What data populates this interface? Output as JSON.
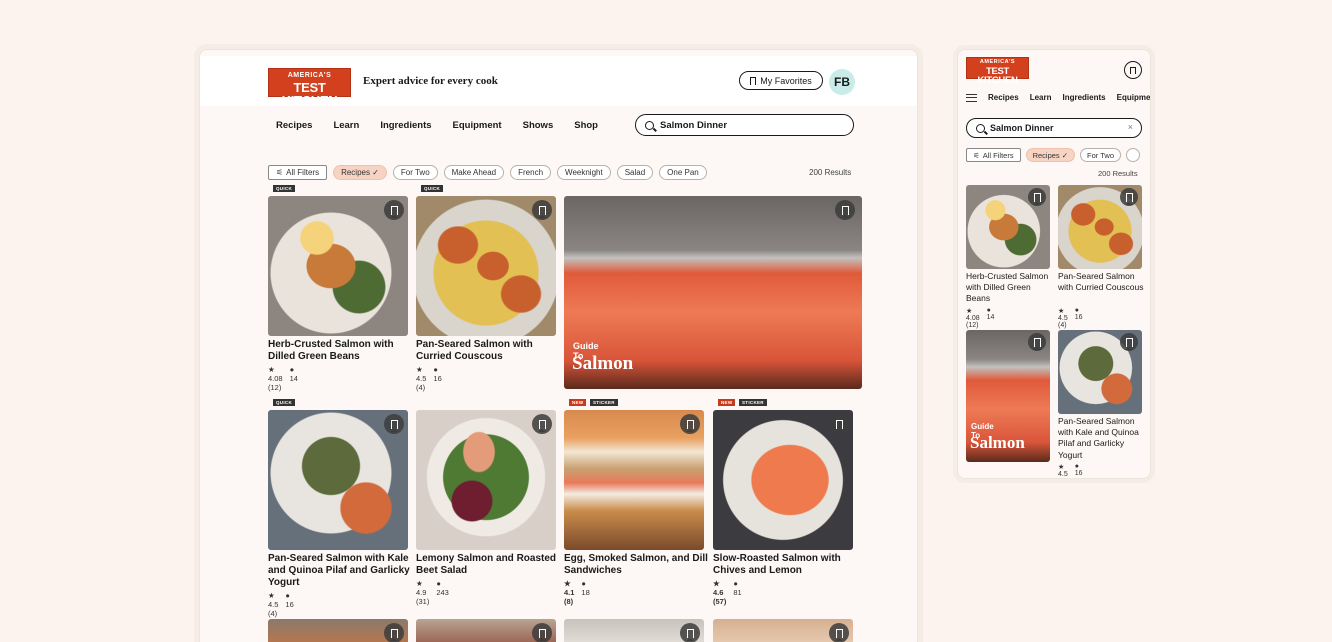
{
  "brand": {
    "line1": "AMERICA'S",
    "line2": "TEST KITCHEN"
  },
  "tagline": "Expert advice for every cook",
  "header": {
    "favorites_label": "My Favorites",
    "avatar_initials": "FB"
  },
  "nav": [
    "Recipes",
    "Learn",
    "Ingredients",
    "Equipment",
    "Shows",
    "Shop"
  ],
  "search": {
    "value": "Salmon Dinner",
    "clear_icon": "×"
  },
  "filters": {
    "all_filters_label": "All Filters",
    "chips": [
      "Recipes ✓",
      "For Two",
      "Make Ahead",
      "French",
      "Weeknight",
      "Salad",
      "One Pan"
    ],
    "results": "200 Results"
  },
  "guide": {
    "small": "Guide To",
    "big": "Salmon"
  },
  "cards": [
    {
      "title": "Herb-Crusted Salmon with Dilled Green Beans",
      "rating": "★ 4.08 (12)",
      "comments": "14",
      "tag": "QUICK"
    },
    {
      "title": "Pan-Seared Salmon with Curried Couscous",
      "rating": "★ 4.5 (4)",
      "comments": "16",
      "tag": "QUICK"
    },
    {
      "title": "Pan-Seared Salmon with Kale and Quinoa Pilaf and Garlicky Yogurt",
      "rating": "★ 4.5 (4)",
      "comments": "16",
      "tag": "QUICK"
    },
    {
      "title": "Lemony Salmon and Roasted Beet Salad",
      "rating": "★ 4.9 (31)",
      "comments": "243",
      "tag": ""
    },
    {
      "title": "Egg, Smoked Salmon, and Dill Sandwiches",
      "rating": "★ 4.1 (8)",
      "comments": "18",
      "tag_new": "NEW",
      "tag": "STICKER"
    },
    {
      "title": "Slow-Roasted Salmon with Chives and Lemon",
      "rating": "★ 4.6 (57)",
      "comments": "81",
      "tag_new": "NEW",
      "tag": "STICKER"
    }
  ],
  "mobile": {
    "nav": [
      "Recipes",
      "Learn",
      "Ingredients",
      "Equipme"
    ],
    "chips": [
      "Recipes ✓",
      "For Two"
    ]
  },
  "colors": {
    "brand_red": "#d2401e",
    "chip_selected": "#f7d3c3",
    "avatar_bg": "#c9ece8",
    "page_bg": "#fcf3ee"
  }
}
